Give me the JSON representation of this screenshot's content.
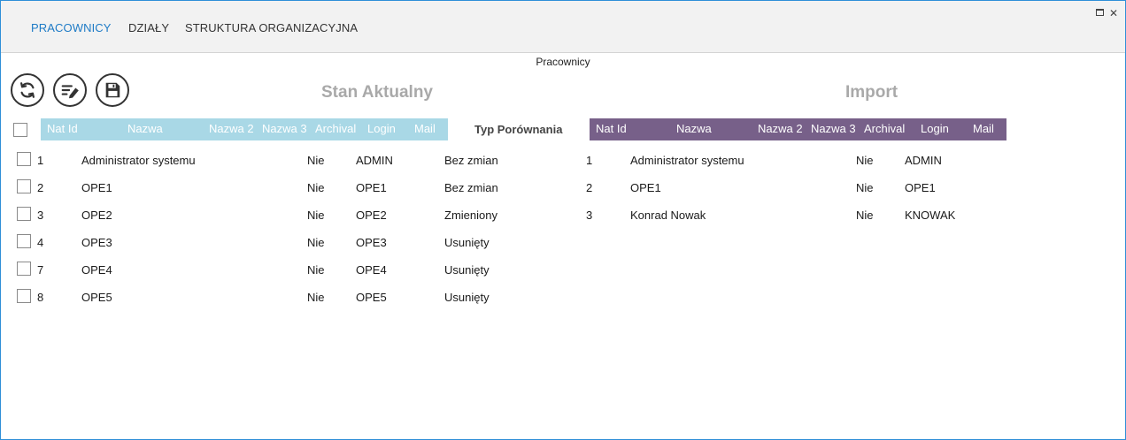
{
  "nav": {
    "tabs": [
      {
        "label": "PRACOWNICY",
        "active": true
      },
      {
        "label": "DZIAŁY",
        "active": false
      },
      {
        "label": "STRUKTURA ORGANIZACYJNA",
        "active": false
      }
    ]
  },
  "window_controls": {
    "close_glyph": "✕"
  },
  "page": {
    "title": "Pracownicy"
  },
  "toolbar": {
    "buttons": [
      {
        "icon": "refresh-icon"
      },
      {
        "icon": "edit-list-icon"
      },
      {
        "icon": "save-icon"
      }
    ]
  },
  "sections": {
    "current": {
      "title": "Stan Aktualny"
    },
    "import": {
      "title": "Import"
    }
  },
  "columns": {
    "current": [
      "Nat Id",
      "Nazwa",
      "Nazwa 2",
      "Nazwa 3",
      "Archival",
      "Login",
      "Mail"
    ],
    "compare": "Typ Porównania",
    "import": [
      "Nat Id",
      "Nazwa",
      "Nazwa 2",
      "Nazwa 3",
      "Archival",
      "Login",
      "Mail"
    ]
  },
  "rows_current": [
    {
      "nat_id": "1",
      "nazwa": "Administrator systemu",
      "archival": "Nie",
      "login": "ADMIN",
      "typ": "Bez zmian"
    },
    {
      "nat_id": "2",
      "nazwa": "OPE1",
      "archival": "Nie",
      "login": "OPE1",
      "typ": "Bez zmian"
    },
    {
      "nat_id": "3",
      "nazwa": "OPE2",
      "archival": "Nie",
      "login": "OPE2",
      "typ": "Zmieniony"
    },
    {
      "nat_id": "4",
      "nazwa": "OPE3",
      "archival": "Nie",
      "login": "OPE3",
      "typ": "Usunięty"
    },
    {
      "nat_id": "7",
      "nazwa": "OPE4",
      "archival": "Nie",
      "login": "OPE4",
      "typ": "Usunięty"
    },
    {
      "nat_id": "8",
      "nazwa": "OPE5",
      "archival": "Nie",
      "login": "OPE5",
      "typ": "Usunięty"
    }
  ],
  "rows_import": [
    {
      "nat_id": "1",
      "nazwa": "Administrator systemu",
      "archival": "Nie",
      "login": "ADMIN"
    },
    {
      "nat_id": "2",
      "nazwa": "OPE1",
      "archival": "Nie",
      "login": "OPE1"
    },
    {
      "nat_id": "3",
      "nazwa": "Konrad Nowak",
      "archival": "Nie",
      "login": "KNOWAK"
    }
  ],
  "colors": {
    "accent": "#1e7bc6",
    "current_header": "#a9d8e6",
    "import_header": "#776089",
    "section_title": "#a9a9a9"
  }
}
